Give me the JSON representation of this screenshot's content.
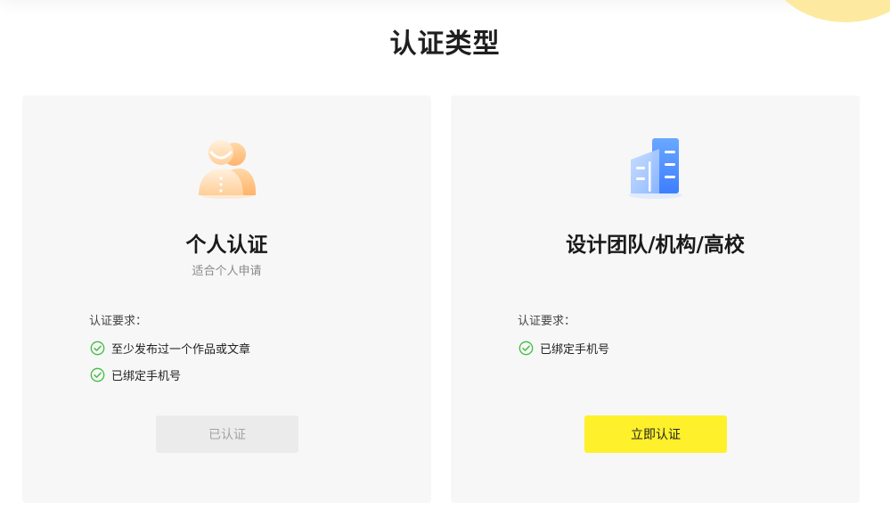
{
  "page": {
    "title": "认证类型"
  },
  "colors": {
    "accent": "#fff02c",
    "check": "#3fbd3f",
    "card_bg": "#f7f7f7"
  },
  "cards": [
    {
      "icon": "person-icon",
      "title": "个人认证",
      "subtitle": "适合个人申请",
      "requirements_label": "认证要求：",
      "requirements": [
        "至少发布过一个作品或文章",
        "已绑定手机号"
      ],
      "button_label": "已认证",
      "button_state": "disabled"
    },
    {
      "icon": "building-icon",
      "title": "设计团队/机构/高校",
      "subtitle": "",
      "requirements_label": "认证要求：",
      "requirements": [
        "已绑定手机号"
      ],
      "button_label": "立即认证",
      "button_state": "enabled"
    }
  ]
}
